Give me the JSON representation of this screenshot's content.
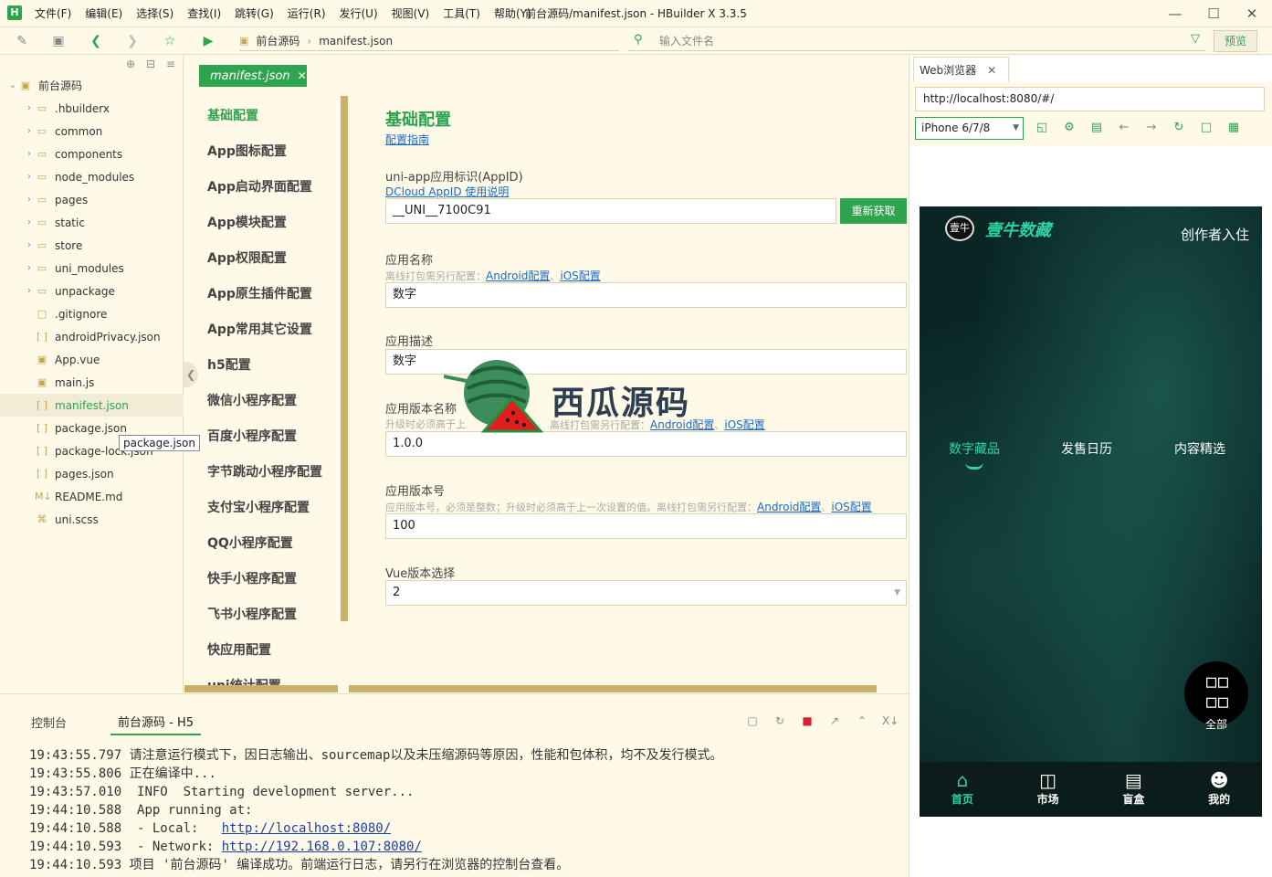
{
  "app": {
    "logo": "H",
    "window_title": "前台源码/manifest.json - HBuilder X 3.3.5",
    "menu": [
      "文件(F)",
      "编辑(E)",
      "选择(S)",
      "查找(I)",
      "跳转(G)",
      "运行(R)",
      "发行(U)",
      "视图(V)",
      "工具(T)",
      "帮助(Y)"
    ]
  },
  "toolbar": {
    "breadcrumb": [
      "前台源码",
      "manifest.json"
    ],
    "file_search_placeholder": "输入文件名",
    "preview_label": "预览"
  },
  "sidebar": {
    "root": "前台源码",
    "items": [
      {
        "label": ".hbuilderx",
        "type": "folder"
      },
      {
        "label": "common",
        "type": "folder"
      },
      {
        "label": "components",
        "type": "folder"
      },
      {
        "label": "node_modules",
        "type": "folder"
      },
      {
        "label": "pages",
        "type": "folder"
      },
      {
        "label": "static",
        "type": "folder"
      },
      {
        "label": "store",
        "type": "folder"
      },
      {
        "label": "uni_modules",
        "type": "folder"
      },
      {
        "label": "unpackage",
        "type": "folder"
      },
      {
        "label": ".gitignore",
        "type": "file"
      },
      {
        "label": "androidPrivacy.json",
        "type": "json"
      },
      {
        "label": "App.vue",
        "type": "vue"
      },
      {
        "label": "main.js",
        "type": "js"
      },
      {
        "label": "manifest.json",
        "type": "json"
      },
      {
        "label": "package.json",
        "type": "json"
      },
      {
        "label": "package-lock.json",
        "type": "json"
      },
      {
        "label": "pages.json",
        "type": "json"
      },
      {
        "label": "README.md",
        "type": "md"
      },
      {
        "label": "uni.scss",
        "type": "scss"
      }
    ],
    "tooltip": "package.json"
  },
  "editor": {
    "tab_label": "manifest.json",
    "nav": [
      "基础配置",
      "App图标配置",
      "App启动界面配置",
      "App模块配置",
      "App权限配置",
      "App原生插件配置",
      "App常用其它设置",
      "h5配置",
      "微信小程序配置",
      "百度小程序配置",
      "字节跳动小程序配置",
      "支付宝小程序配置",
      "QQ小程序配置",
      "快手小程序配置",
      "飞书小程序配置",
      "快应用配置",
      "uni统计配置"
    ],
    "form": {
      "heading": "基础配置",
      "guide_link": "配置指南",
      "appid_label": "uni-app应用标识(AppID)",
      "appid_link": "DCloud AppID 使用说明",
      "appid_value": "__UNI__7100C91",
      "refetch_label": "重新获取",
      "name_label": "应用名称",
      "name_note": "离线打包需另行配置：",
      "android_link": "Android配置",
      "sep": "、",
      "ios_link": "iOS配置",
      "name_value": "数字",
      "desc_label": "应用描述",
      "desc_value": "数字",
      "version_name_label": "应用版本名称",
      "version_name_note": "升级时必须高于上",
      "version_name_note2": "离线打包需另行配置：",
      "version_name_value": "1.0.0",
      "version_code_label": "应用版本号",
      "version_code_note": "应用版本号，必须是整数；升级时必须高于上一次设置的值。离线打包需另行配置：",
      "version_code_value": "100",
      "vue_label": "Vue版本选择",
      "vue_value": "2"
    }
  },
  "watermark": {
    "text": "西瓜源码"
  },
  "browser": {
    "tab_label": "Web浏览器",
    "url": "http://localhost:8080/#/",
    "device": "iPhone 6/7/8"
  },
  "phone": {
    "logo_text": "壹牛",
    "brand": "壹牛数藏",
    "join": "创作者入住",
    "tabs": [
      "数字藏品",
      "发售日历",
      "内容精选"
    ],
    "fab_label": "全部",
    "nav": [
      {
        "label": "首页",
        "icon": "home-icon"
      },
      {
        "label": "市场",
        "icon": "shop-icon"
      },
      {
        "label": "盲盒",
        "icon": "gift-icon"
      },
      {
        "label": "我的",
        "icon": "user-icon"
      }
    ]
  },
  "console": {
    "tab_console": "控制台",
    "tab_h5": "前台源码 - H5",
    "lines": [
      {
        "time": "19:43:55.797",
        "text": " 请注意运行模式下，因日志输出、sourcemap以及未压缩源码等原因，性能和包体积，均不及发行模式。"
      },
      {
        "time": "19:43:55.806",
        "text": " 正在编译中..."
      },
      {
        "time": "19:43:57.010",
        "text": "  INFO  Starting development server..."
      },
      {
        "time": "19:44:10.588",
        "text": "  App running at:"
      },
      {
        "time": "19:44:10.588",
        "text": "  - Local:   ",
        "link": "http://localhost:8080/"
      },
      {
        "time": "19:44:10.593",
        "text": "  - Network: ",
        "link": "http://192.168.0.107:8080/"
      },
      {
        "time": "19:44:10.593",
        "text": " 项目 '前台源码' 编译成功。前端运行日志，请另行在浏览器的控制台查看。"
      }
    ]
  }
}
